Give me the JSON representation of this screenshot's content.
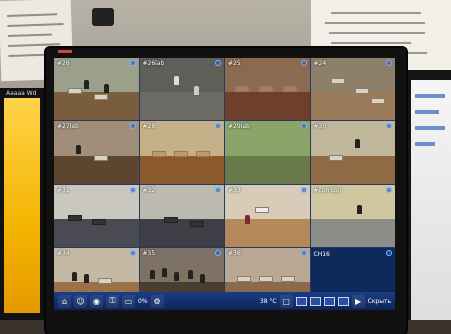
{
  "side_monitor": {
    "label": "Aaaaa Wd"
  },
  "cameras": [
    {
      "label": "#26"
    },
    {
      "label": "#26lab"
    },
    {
      "label": "#25"
    },
    {
      "label": "#24"
    },
    {
      "label": "#27lab"
    },
    {
      "label": "#28"
    },
    {
      "label": "#29lab"
    },
    {
      "label": "#30"
    },
    {
      "label": "#31"
    },
    {
      "label": "#32"
    },
    {
      "label": "#33"
    },
    {
      "label": "#corridor"
    },
    {
      "label": "#34"
    },
    {
      "label": "#35"
    },
    {
      "label": "#36"
    },
    {
      "label": "CH16"
    }
  ],
  "taskbar": {
    "percent": "0%",
    "temperature": "38 °C",
    "hide_label": "Скрыть"
  },
  "colors": {
    "taskbar": "#1b3d86",
    "grid_lines": "#233a66",
    "accent": "#7fb3ff"
  }
}
